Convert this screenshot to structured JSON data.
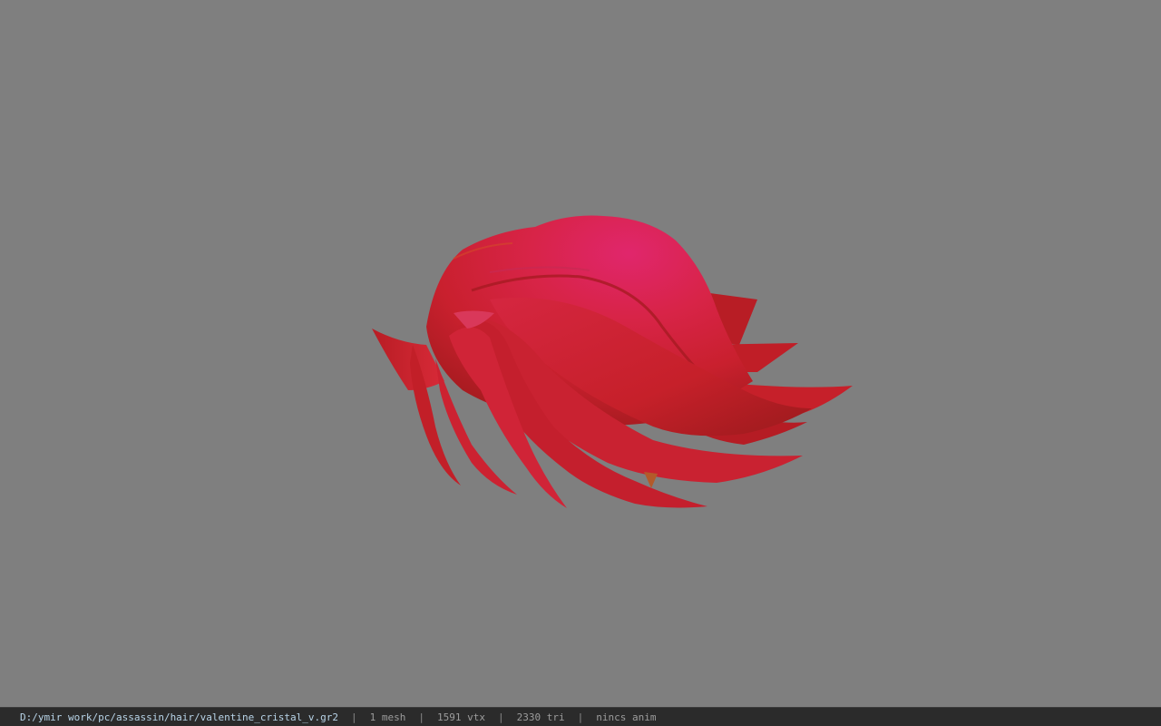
{
  "viewer": {
    "background_color": "#7f7f7f",
    "model_colors": {
      "base": "#d2222f",
      "highlight": "#e2286a",
      "shadow": "#9e1a1e",
      "accent": "#c43a22"
    }
  },
  "statusbar": {
    "file_path": "D:/ymir work/pc/assassin/hair/valentine_cristal_v.gr2",
    "sep1": "|",
    "mesh": "1 mesh",
    "sep2": "|",
    "vtx": "1591 vtx",
    "sep3": "|",
    "tri": "2330 tri",
    "sep4": "|",
    "anim": "nincs anim"
  }
}
